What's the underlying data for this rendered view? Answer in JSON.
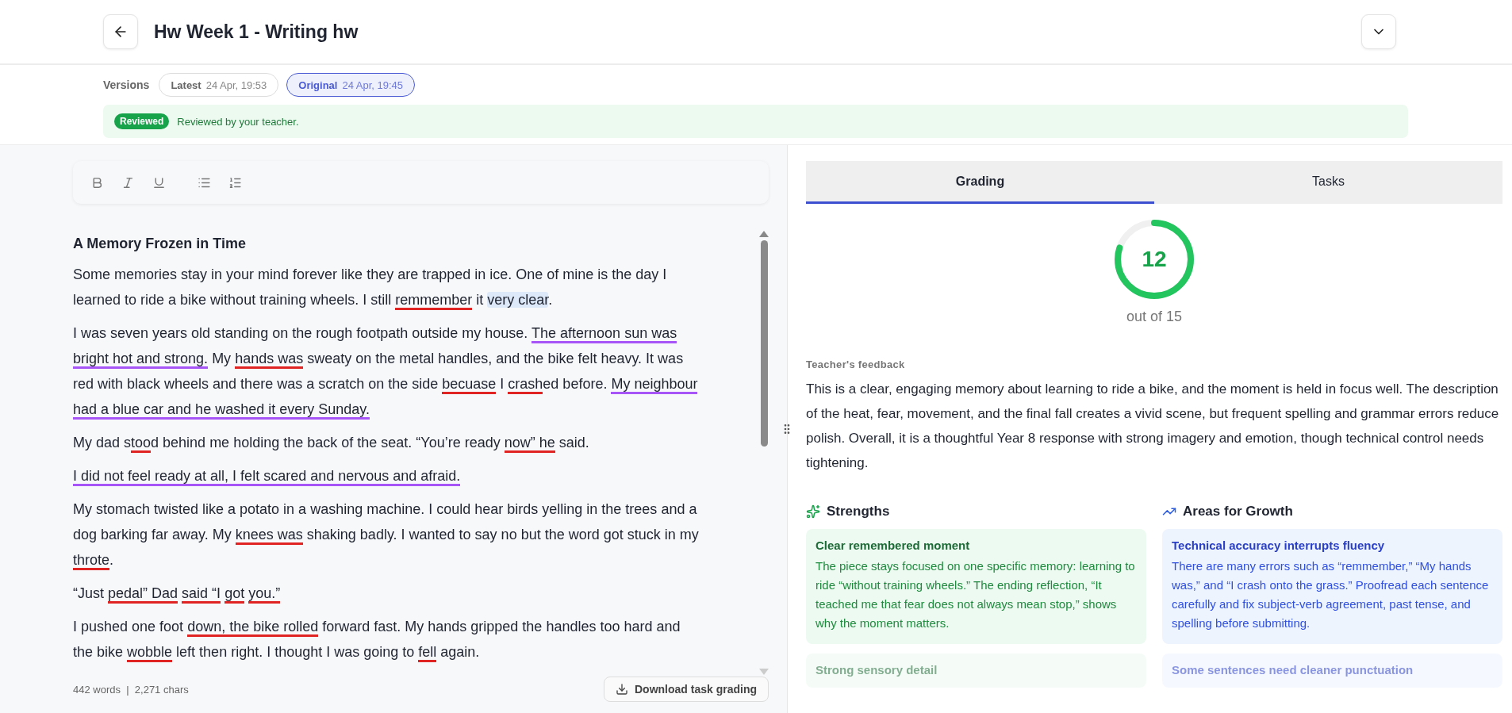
{
  "header": {
    "title": "Hw Week 1 - Writing hw"
  },
  "versions": {
    "label": "Versions",
    "items": [
      {
        "name": "Latest",
        "time": "24 Apr, 19:53",
        "selected": false
      },
      {
        "name": "Original",
        "time": "24 Apr, 19:45",
        "selected": true
      }
    ]
  },
  "review": {
    "badge": "Reviewed",
    "message": "Reviewed by your teacher."
  },
  "essay": {
    "title": "A Memory Frozen in Time",
    "paragraphs": [
      [
        {
          "text": "Some memories stay in your mind forever like they are trapped in ice. One of mine is the day I learned to ride a bike without training wheels. I still ",
          "kind": "plain"
        },
        {
          "text": "remmember",
          "kind": "error"
        },
        {
          "text": " it ",
          "kind": "plain"
        },
        {
          "text": "very clear",
          "kind": "highlight"
        },
        {
          "text": ".",
          "kind": "plain"
        }
      ],
      [
        {
          "text": "I was seven years old standing on the rough footpath outside my house. ",
          "kind": "plain"
        },
        {
          "text": "The afternoon sun was bright hot and strong.",
          "kind": "style"
        },
        {
          "text": " My ",
          "kind": "plain"
        },
        {
          "text": "hands was",
          "kind": "error"
        },
        {
          "text": " sweaty on the metal handles, and the bike felt heavy. It was red with black wheels and there was a scratch on the side ",
          "kind": "plain"
        },
        {
          "text": "becuase",
          "kind": "error"
        },
        {
          "text": " I ",
          "kind": "plain"
        },
        {
          "text": "crash",
          "kind": "error"
        },
        {
          "text": "ed before. ",
          "kind": "plain"
        },
        {
          "text": "My neighbour had a blue car and he washed it every Sunday.",
          "kind": "style"
        }
      ],
      [
        {
          "text": "My dad s",
          "kind": "plain"
        },
        {
          "text": "too",
          "kind": "error"
        },
        {
          "text": "d behind me holding the back of the seat. “You’re ready ",
          "kind": "plain"
        },
        {
          "text": "now” he",
          "kind": "error"
        },
        {
          "text": " said.",
          "kind": "plain"
        }
      ],
      [
        {
          "text": "I did not feel ready at all, I felt scared and nervous and afraid.",
          "kind": "style"
        }
      ],
      [
        {
          "text": "My stomach twisted like a potato in a washing machine. I could hear birds yelling in the trees and a dog barking far away. My ",
          "kind": "plain"
        },
        {
          "text": "knees was",
          "kind": "error"
        },
        {
          "text": " shaking badly. I wanted to say no but the word got stuck in my ",
          "kind": "plain"
        },
        {
          "text": "throte",
          "kind": "error"
        },
        {
          "text": ".",
          "kind": "plain"
        }
      ],
      [
        {
          "text": "“Just ",
          "kind": "plain"
        },
        {
          "text": "pedal” Dad",
          "kind": "error",
          "space_after": true
        },
        {
          "text": "said “I",
          "kind": "error",
          "space_after": true
        },
        {
          "text": "got",
          "kind": "error",
          "space_after": true
        },
        {
          "text": "you.”",
          "kind": "error"
        }
      ],
      [
        {
          "text": "I pushed one foot ",
          "kind": "plain"
        },
        {
          "text": "down, the bike rolled",
          "kind": "error"
        },
        {
          "text": " forward fast. My hands gripped the handles too hard and the bike ",
          "kind": "plain"
        },
        {
          "text": "wobble",
          "kind": "error"
        },
        {
          "text": " left then right. I thought I was going to ",
          "kind": "plain"
        },
        {
          "text": "fell",
          "kind": "error"
        },
        {
          "text": " again.",
          "kind": "plain"
        }
      ]
    ]
  },
  "footer": {
    "counts": "442 words  |  2,271 chars",
    "download": "Download task grading"
  },
  "tabs": [
    {
      "label": "Grading",
      "selected": true
    },
    {
      "label": "Tasks",
      "selected": false
    }
  ],
  "score": {
    "value": "12",
    "level": 0.8,
    "caption": "out of 15"
  },
  "feedback": {
    "label": "Teacher's feedback",
    "text": "This is a clear, engaging memory about learning to ride a bike, and the moment is held in focus well. The description of the heat, fear, movement, and the final fall creates a vivid scene, but frequent spelling and grammar errors reduce polish. Overall, it is a thoughtful Year 8 response with strong imagery and emotion, though technical control needs tightening."
  },
  "columns": [
    {
      "kind": "strengths",
      "heading": "Strengths",
      "cards": [
        {
          "title": "Clear remembered moment",
          "body": "The piece stays focused on one specific memory: learning to ride “without training wheels.” The ending reflection, “It teached me that fear does not always mean stop,” shows why the moment matters."
        },
        {
          "title": "Strong sensory detail"
        }
      ]
    },
    {
      "kind": "growth",
      "heading": "Areas for Growth",
      "cards": [
        {
          "title": "Technical accuracy interrupts fluency",
          "body": "There are many errors such as “remmember,” “My hands was,” and “I crash onto the grass.” Proofread each sentence carefully and fix subject-verb agreement, past tense, and spelling before submitting."
        },
        {
          "title": "Some sentences need cleaner punctuation"
        }
      ]
    }
  ]
}
